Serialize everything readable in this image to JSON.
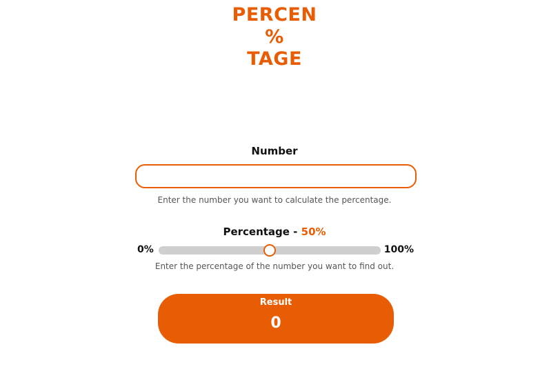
{
  "logo": {
    "line1": "PERCEN",
    "line2": "%",
    "line3": "TAGE"
  },
  "number_field": {
    "label": "Number",
    "value": "",
    "placeholder": "",
    "hint": "Enter the number you want to calculate the percentage."
  },
  "percentage_field": {
    "label_prefix": "Percentage - ",
    "value_text": "50%",
    "value": 50,
    "min_label": "0%",
    "max_label": "100%",
    "hint": "Enter the percentage of the number you want to find out."
  },
  "result": {
    "title": "Result",
    "value": "0"
  },
  "colors": {
    "accent": "#e85d04",
    "track": "#cfcfcf",
    "text": "#111111",
    "hint": "#555555"
  }
}
